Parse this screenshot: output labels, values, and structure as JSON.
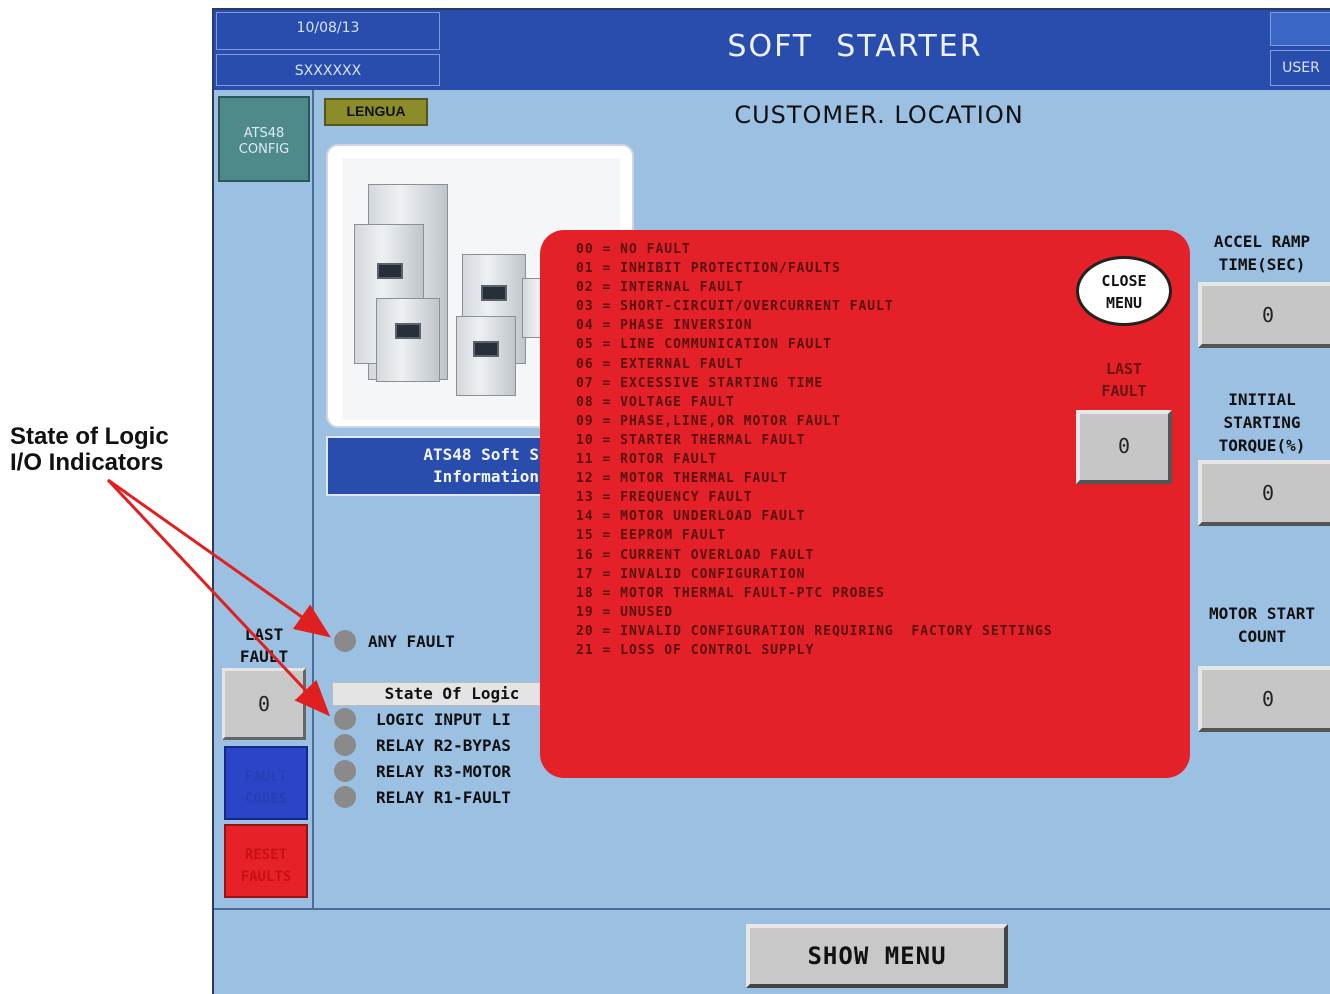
{
  "annotation": {
    "line1": "State of Logic",
    "line2": "I/O Indicators",
    "arrow_color": "#e02020"
  },
  "header": {
    "date": "10/08/13",
    "code": "SXXXXXX",
    "title": "SOFT  STARTER",
    "user_label": "USER"
  },
  "sidebar": {
    "config_button": "ATS48\nCONFIG",
    "last_fault_label": "LAST\nFAULT",
    "last_fault_value": "0",
    "fault_codes_button": "FAULT\nCODES",
    "reset_button": "RESET\nFAULTS"
  },
  "main": {
    "language_button": "LENGUA",
    "location_title": "CUSTOMER. LOCATION",
    "info_box": "ATS48 Soft St\nInformation",
    "any_fault_label": "ANY FAULT",
    "state_header": "State Of Logic",
    "indicators": [
      "LOGIC INPUT LI",
      "RELAY R2-BYPAS",
      "RELAY R3-MOTOR",
      "RELAY R1-FAULT"
    ]
  },
  "right_panel": {
    "accel_label": "ACCEL RAMP\nTIME(SEC)",
    "accel_value": "0",
    "torque_label": "INITIAL\nSTARTING\nTORQUE(%)",
    "torque_value": "0",
    "count_label": "MOTOR START\nCOUNT",
    "count_value": "0"
  },
  "popup": {
    "faults": [
      "00 = NO FAULT",
      "01 = INHIBIT PROTECTION/FAULTS",
      "02 = INTERNAL FAULT",
      "03 = SHORT-CIRCUIT/OVERCURRENT FAULT",
      "04 = PHASE INVERSION",
      "05 = LINE COMMUNICATION FAULT",
      "06 = EXTERNAL FAULT",
      "07 = EXCESSIVE STARTING TIME",
      "08 = VOLTAGE FAULT",
      "09 = PHASE,LINE,OR MOTOR FAULT",
      "10 = STARTER THERMAL FAULT",
      "11 = ROTOR FAULT",
      "12 = MOTOR THERMAL FAULT",
      "13 = FREQUENCY FAULT",
      "14 = MOTOR UNDERLOAD FAULT",
      "15 = EEPROM FAULT",
      "16 = CURRENT OVERLOAD FAULT",
      "17 = INVALID CONFIGURATION",
      "18 = MOTOR THERMAL FAULT-PTC PROBES",
      "19 = UNUSED",
      "20 = INVALID CONFIGURATION REQUIRING  FACTORY SETTINGS",
      "21 = LOSS OF CONTROL SUPPLY"
    ],
    "close_button": "CLOSE\nMENU",
    "last_fault_label": "LAST\nFAULT",
    "last_fault_value": "0"
  },
  "footer": {
    "show_menu_button": "SHOW MENU"
  },
  "colors": {
    "panel_bg": "#9cc0e2",
    "header_blue": "#284dac",
    "popup_red": "#e42028",
    "indicator_gray": "#8a8a8a"
  }
}
